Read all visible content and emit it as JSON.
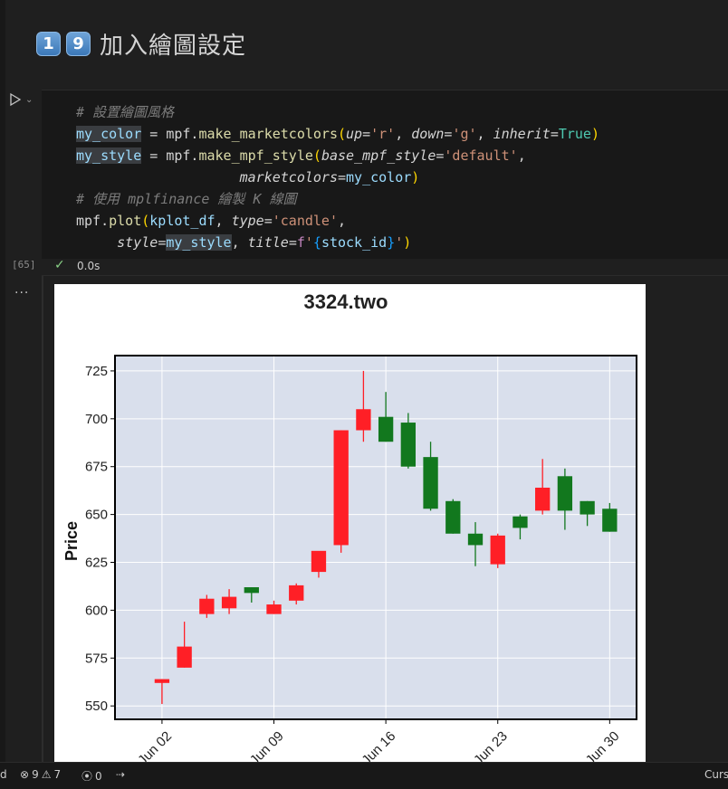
{
  "heading": {
    "key1": "1",
    "key2": "9",
    "text": "加入繪圖設定"
  },
  "cell": {
    "execution_count": "[65]",
    "status_check": "✓",
    "status_time": "0.0s",
    "code": {
      "comment1": "# 設置繪圖風格",
      "l2_var": "my_color",
      "l2_eq": " = mpf.",
      "l2_fn": "make_marketcolors",
      "l2_p1": "up",
      "l2_v1": "'r'",
      "l2_p2": "down",
      "l2_v2": "'g'",
      "l2_p3": "inherit",
      "l2_v3": "True",
      "l3_var": "my_style",
      "l3_eq": " = mpf.",
      "l3_fn": "make_mpf_style",
      "l3_p1": "base_mpf_style",
      "l3_v1": "'default'",
      "l4_p": "marketcolors",
      "l4_v": "my_color",
      "comment2": "# 使用 mplfinance 繪製 K 線圖",
      "l6_mod": "mpf.",
      "l6_fn": "plot",
      "l6_arg": "kplot_df",
      "l6_p": "type",
      "l6_v": "'candle'",
      "l7_p1": "style",
      "l7_v1": "my_style",
      "l7_p2": "title",
      "l7_f": "f",
      "l7_q1": "'",
      "l7_in": "stock_id",
      "l7_q2": "'"
    }
  },
  "output": {
    "menu": "..."
  },
  "statusbar": {
    "left_char": "d",
    "errors": "9",
    "warnings": "7",
    "ports": "0",
    "right_text": "Curs"
  },
  "colors": {
    "up": "#ff1f26",
    "down": "#12781e",
    "plot_bg": "#d9dfec"
  },
  "chart_data": {
    "type": "candlestick",
    "title": "3324.two",
    "ylabel": "Price",
    "ylim": [
      543,
      733
    ],
    "yticks": [
      550,
      575,
      600,
      625,
      650,
      675,
      700,
      725
    ],
    "xtick_labels": [
      {
        "label": "Jun 02",
        "index": 0
      },
      {
        "label": "Jun 09",
        "index": 5
      },
      {
        "label": "Jun 16",
        "index": 10
      },
      {
        "label": "Jun 23",
        "index": 15
      },
      {
        "label": "Jun 30",
        "index": 20
      }
    ],
    "x_range": [
      -2.1,
      21.2
    ],
    "grid": true,
    "candles": [
      {
        "open": 562,
        "high": 564,
        "low": 551,
        "close": 564
      },
      {
        "open": 570,
        "high": 594,
        "low": 570,
        "close": 581
      },
      {
        "open": 598,
        "high": 608,
        "low": 596,
        "close": 606
      },
      {
        "open": 601,
        "high": 611,
        "low": 598,
        "close": 607
      },
      {
        "open": 612,
        "high": 612,
        "low": 604,
        "close": 609
      },
      {
        "open": 598,
        "high": 605,
        "low": 598,
        "close": 603
      },
      {
        "open": 605,
        "high": 614,
        "low": 603,
        "close": 613
      },
      {
        "open": 620,
        "high": 630,
        "low": 617,
        "close": 631
      },
      {
        "open": 634,
        "high": 694,
        "low": 630,
        "close": 694
      },
      {
        "open": 694,
        "high": 725,
        "low": 688,
        "close": 705
      },
      {
        "open": 701,
        "high": 714,
        "low": 688,
        "close": 688
      },
      {
        "open": 698,
        "high": 703,
        "low": 674,
        "close": 675
      },
      {
        "open": 680,
        "high": 688,
        "low": 652,
        "close": 653
      },
      {
        "open": 657,
        "high": 658,
        "low": 640,
        "close": 640
      },
      {
        "open": 640,
        "high": 646,
        "low": 623,
        "close": 634
      },
      {
        "open": 624,
        "high": 640,
        "low": 622,
        "close": 639
      },
      {
        "open": 649,
        "high": 650,
        "low": 637,
        "close": 643
      },
      {
        "open": 652,
        "high": 679,
        "low": 650,
        "close": 664
      },
      {
        "open": 670,
        "high": 674,
        "low": 642,
        "close": 652
      },
      {
        "open": 657,
        "high": 657,
        "low": 644,
        "close": 650
      },
      {
        "open": 653,
        "high": 656,
        "low": 641,
        "close": 641
      }
    ]
  }
}
